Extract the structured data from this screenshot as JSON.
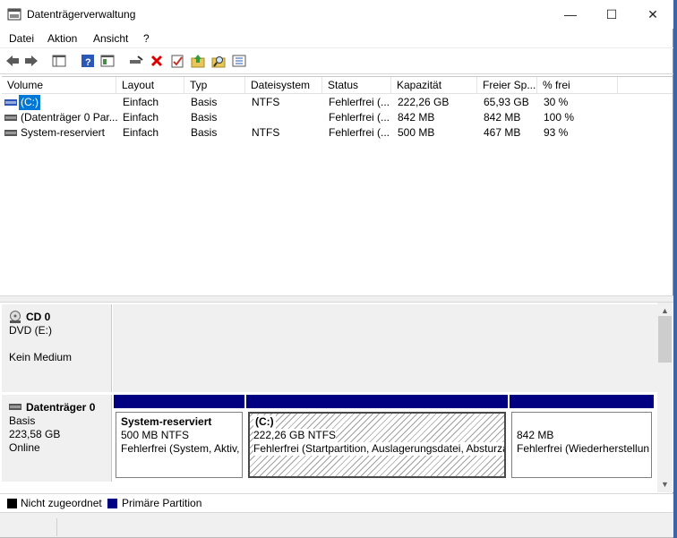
{
  "window": {
    "title": "Datenträgerverwaltung",
    "minimize": "—",
    "maximize": "☐",
    "close": "✕"
  },
  "menu": [
    "Datei",
    "Aktion",
    "Ansicht",
    "?"
  ],
  "columns": [
    "Volume",
    "Layout",
    "Typ",
    "Dateisystem",
    "Status",
    "Kapazität",
    "Freier Sp...",
    "% frei"
  ],
  "volumes": [
    {
      "volume": "(C:)",
      "layout": "Einfach",
      "type": "Basis",
      "fs": "NTFS",
      "status": "Fehlerfrei (...",
      "capacity": "222,26 GB",
      "free": "65,93 GB",
      "pct": "30 %",
      "selected": true
    },
    {
      "volume": "(Datenträger 0 Par...",
      "layout": "Einfach",
      "type": "Basis",
      "fs": "",
      "status": "Fehlerfrei (...",
      "capacity": "842 MB",
      "free": "842 MB",
      "pct": "100 %",
      "selected": false
    },
    {
      "volume": "System-reserviert",
      "layout": "Einfach",
      "type": "Basis",
      "fs": "NTFS",
      "status": "Fehlerfrei (...",
      "capacity": "500 MB",
      "free": "467 MB",
      "pct": "93 %",
      "selected": false
    }
  ],
  "cd": {
    "name": "CD 0",
    "type": "DVD (E:)",
    "media": "Kein Medium"
  },
  "disk0": {
    "name": "Datenträger 0",
    "type": "Basis",
    "size": "223,58 GB",
    "state": "Online"
  },
  "partitions": [
    {
      "name": "System-reserviert",
      "size": "500 MB NTFS",
      "status": "Fehlerfrei (System, Aktiv,"
    },
    {
      "name": "(C:)",
      "size": "222,26 GB NTFS",
      "status": "Fehlerfrei (Startpartition, Auslagerungsdatei, Absturza"
    },
    {
      "name": "",
      "size": "842 MB",
      "status": "Fehlerfrei (Wiederherstellun"
    }
  ],
  "legend": {
    "unallocated": "Nicht zugeordnet",
    "primary": "Primäre Partition"
  },
  "colors": {
    "primary": "#000080",
    "unallocated": "#000000",
    "selection": "#0078d7"
  }
}
